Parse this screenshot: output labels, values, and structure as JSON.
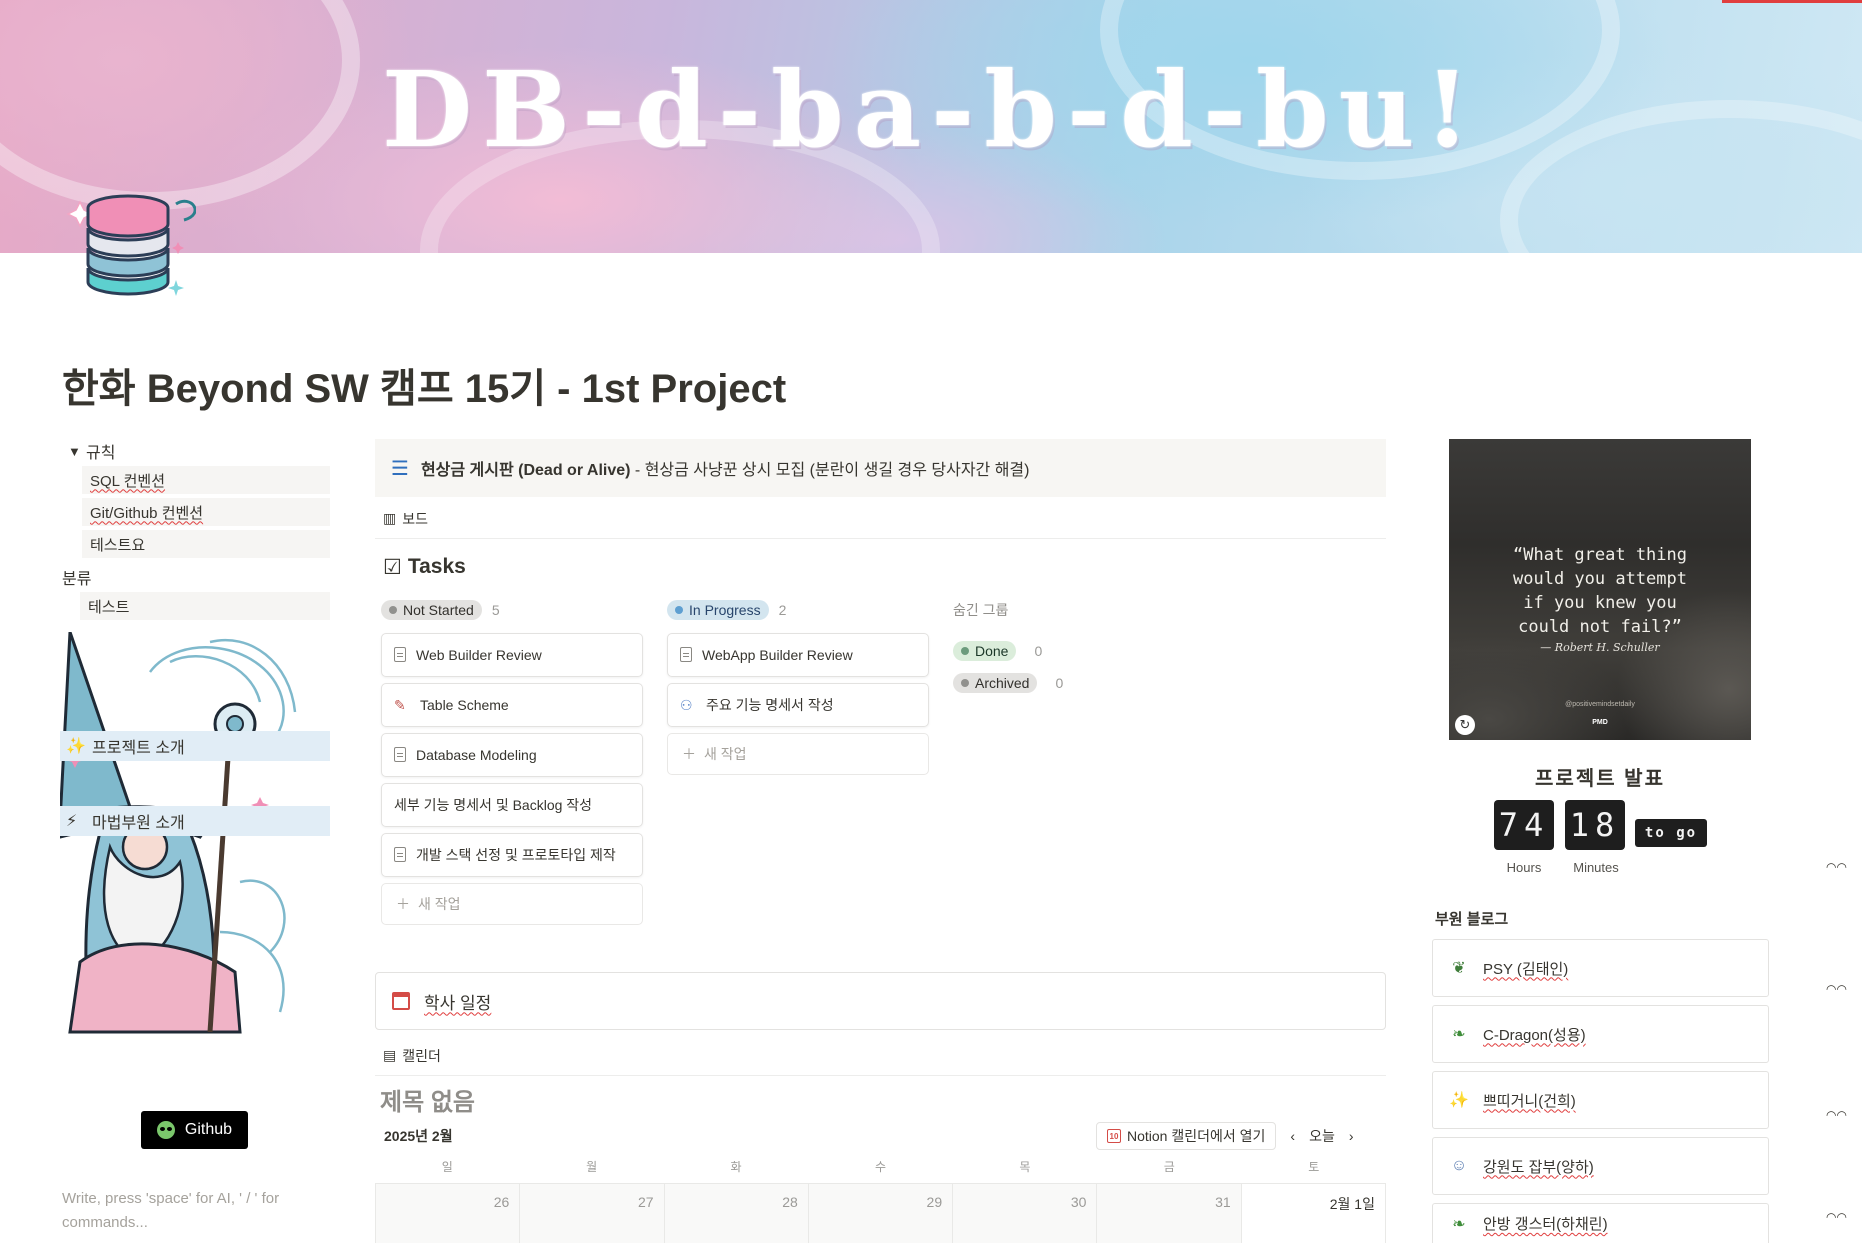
{
  "cover": {
    "title": "DB-d-ba-b-d-bu!"
  },
  "page": {
    "title": "한화 Beyond SW 캠프 15기 - 1st Project"
  },
  "rules": {
    "toggle_label": "규칙",
    "items": [
      "SQL 컨벤션",
      "Git/Github 컨벤션",
      "테스트요"
    ]
  },
  "category": {
    "label": "분류",
    "items": [
      "테스트"
    ]
  },
  "links": {
    "project_intro": "프로젝트 소개",
    "members_intro": "마법부원 소개"
  },
  "github_button": "Github",
  "editor_placeholder": "Write, press 'space' for AI, ' / ' for commands...",
  "bounty": {
    "title_bold": "현상금 게시판 (Dead or Alive)",
    "title_rest": " - 현상금 사냥꾼 상시 모집 (분란이 생길 경우 당사자간 해결)"
  },
  "tasks_db": {
    "view_label": "보드",
    "title": "Tasks",
    "columns": [
      {
        "status": "Not Started",
        "count": "5",
        "cards": [
          "Web Builder Review",
          "Table Scheme",
          "Database Modeling",
          "세부 기능 명세서 및 Backlog 작성",
          "개발 스택 선정 및 프로토타입 제작"
        ]
      },
      {
        "status": "In Progress",
        "count": "2",
        "cards": [
          "WebApp Builder Review",
          "주요 기능 명세서 작성"
        ]
      }
    ],
    "new_label": "새 작업",
    "hidden_groups_label": "숨긴 그룹",
    "hidden_groups": [
      {
        "status": "Done",
        "count": "0"
      },
      {
        "status": "Archived",
        "count": "0"
      }
    ]
  },
  "calendar": {
    "callout": "학사 일정",
    "view_label": "캘린더",
    "title": "제목 없음",
    "month": "2025년 2월",
    "open_in_notion": "Notion 캘린더에서 열기",
    "mini_icon_number": "10",
    "today": "오늘",
    "weekdays": [
      "일",
      "월",
      "화",
      "수",
      "목",
      "금",
      "토"
    ],
    "dates": [
      "26",
      "27",
      "28",
      "29",
      "30",
      "31",
      "2월 1일"
    ]
  },
  "quote": {
    "line1": "“What great thing",
    "line2": "would you attempt",
    "line3": "if you knew you",
    "line4": "could not fail?”",
    "author": "— Robert H. Schuller",
    "handle": "@positivemindsetdaily",
    "brand": "PMD"
  },
  "countdown": {
    "title": "프로젝트 발표",
    "hours": "74",
    "minutes": "18",
    "to_go": "to go",
    "hours_label": "Hours",
    "minutes_label": "Minutes"
  },
  "blogs": {
    "heading": "부원 블로그",
    "items": [
      {
        "name": "PSY (김태인)",
        "icon": "feather-icon"
      },
      {
        "name": "C-Dragon(성용)",
        "icon": "dragon-icon"
      },
      {
        "name": "쁘띠거니(건희)",
        "icon": "sparkle-icon"
      },
      {
        "name": "강원도 잡부(양하)",
        "icon": "person-icon"
      },
      {
        "name": "안방 갱스터(하채린)",
        "icon": "dragon-icon"
      }
    ]
  },
  "colors": {
    "accent_red": "#e03e3e",
    "link_block_bg": "#e1edf6",
    "status_blue": "#d3e5ef",
    "status_green": "#dbeddb",
    "status_grey": "#e3e2e0"
  }
}
